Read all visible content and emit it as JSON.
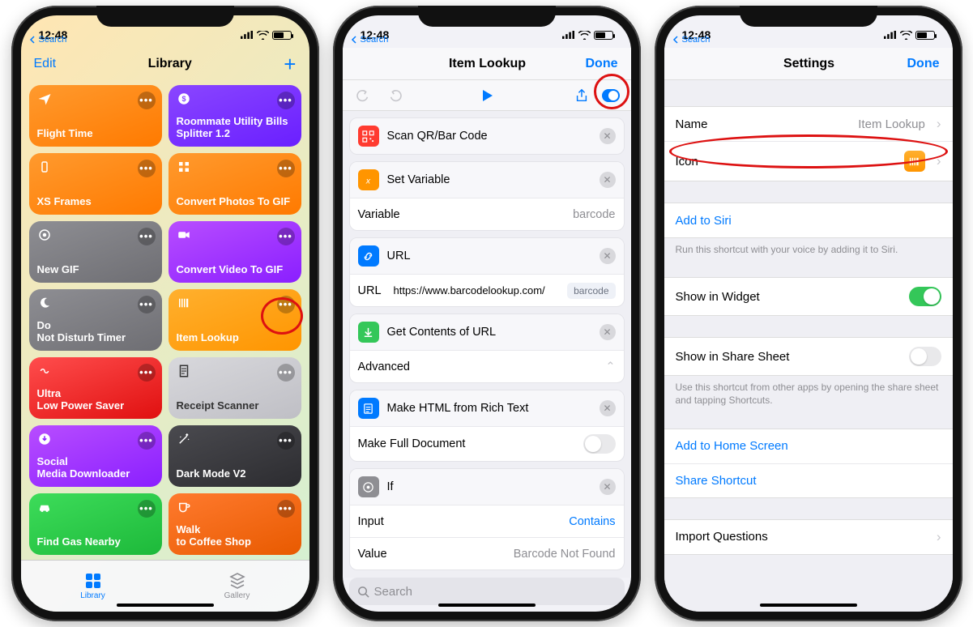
{
  "status": {
    "time": "12:48",
    "back": "Search"
  },
  "s1": {
    "edit": "Edit",
    "title": "Library",
    "tiles": [
      {
        "label": "Flight Time",
        "bg": "linear-gradient(160deg,#ff9a2e,#ff7a00)",
        "icon": "plane"
      },
      {
        "label": "Roommate Utility Bills Splitter 1.2",
        "bg": "linear-gradient(160deg,#8a46ff,#6a1fff)",
        "icon": "dollar"
      },
      {
        "label": "XS Frames",
        "bg": "linear-gradient(160deg,#ff9a2e,#ff7a00)",
        "icon": "phone"
      },
      {
        "label": "Convert Photos To GIF",
        "bg": "linear-gradient(160deg,#ff9a2e,#ff7a00)",
        "icon": "grid"
      },
      {
        "label": "New GIF",
        "bg": "linear-gradient(160deg,#8e8e93,#6e6e73)",
        "icon": "target"
      },
      {
        "label": "Convert Video To GIF",
        "bg": "linear-gradient(160deg,#b84dff,#8a1fff)",
        "icon": "video"
      },
      {
        "label": "Do\nNot Disturb Timer",
        "bg": "linear-gradient(160deg,#8e8e93,#6e6e73)",
        "icon": "moon"
      },
      {
        "label": "Item Lookup",
        "bg": "linear-gradient(160deg,#ffb02e,#ff9500)",
        "icon": "barcode"
      },
      {
        "label": "Ultra\nLow Power Saver",
        "bg": "linear-gradient(160deg,#ff4d4d,#e01010)",
        "icon": "infinity"
      },
      {
        "label": "Receipt Scanner",
        "bg": "linear-gradient(160deg,#d8d8dc,#bfbfc5)",
        "icon": "receipt",
        "fg": "#333"
      },
      {
        "label": "Social\nMedia Downloader",
        "bg": "linear-gradient(160deg,#b84dff,#8a1fff)",
        "icon": "download"
      },
      {
        "label": "Dark Mode V2",
        "bg": "linear-gradient(160deg,#4a4a4f,#2c2c30)",
        "icon": "wand"
      },
      {
        "label": "Find Gas Nearby",
        "bg": "linear-gradient(160deg,#3ddc5a,#1db93a)",
        "icon": "car"
      },
      {
        "label": "Walk\nto Coffee Shop",
        "bg": "linear-gradient(160deg,#ff7a2e,#e85a00)",
        "icon": "cup"
      }
    ],
    "tabs": {
      "library": "Library",
      "gallery": "Gallery"
    }
  },
  "s2": {
    "title": "Item Lookup",
    "done": "Done",
    "actions": {
      "scan": "Scan QR/Bar Code",
      "setvar": "Set Variable",
      "var_label": "Variable",
      "var_value": "barcode",
      "url_head": "URL",
      "url_label": "URL",
      "url_value": "https://www.barcodelookup.com/",
      "url_pill": "barcode",
      "get": "Get Contents of URL",
      "advanced": "Advanced",
      "make_html": "Make HTML from Rich Text",
      "make_full": "Make Full Document",
      "if": "If",
      "input": "Input",
      "input_val": "Contains",
      "value": "Value",
      "value_val": "Barcode Not Found"
    },
    "search_ph": "Search"
  },
  "s3": {
    "title": "Settings",
    "done": "Done",
    "name_label": "Name",
    "name_value": "Item Lookup",
    "icon_label": "Icon",
    "add_siri": "Add to Siri",
    "siri_note": "Run this shortcut with your voice by adding it to Siri.",
    "show_widget": "Show in Widget",
    "show_share": "Show in Share Sheet",
    "share_note": "Use this shortcut from other apps by opening the share sheet and tapping Shortcuts.",
    "add_home": "Add to Home Screen",
    "share_sc": "Share Shortcut",
    "import_q": "Import Questions"
  }
}
